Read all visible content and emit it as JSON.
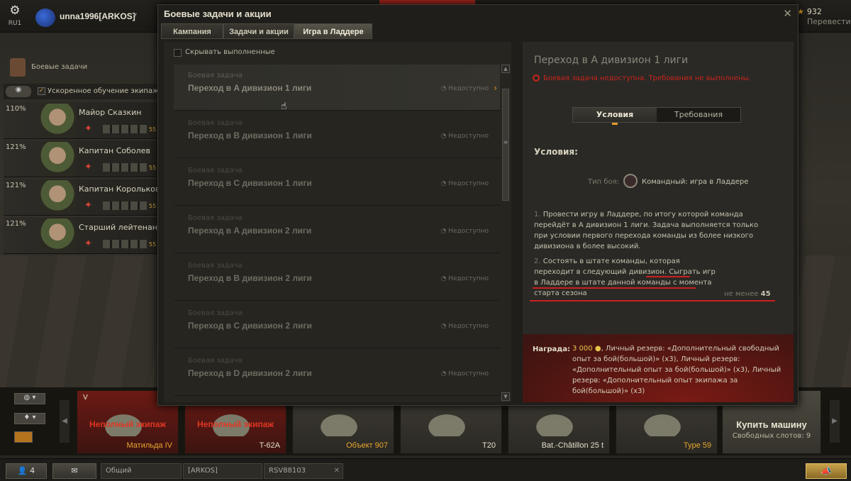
{
  "topbar": {
    "region": "RU1",
    "username": "unna1996[ARKOS]",
    "gold": "932",
    "translate": "Перевести"
  },
  "side": {
    "missions_label": "Боевые задачи",
    "crew_filter_label": "Ускоренное обучение экипажа",
    "crew": [
      {
        "pct": "110%",
        "name": "Майор Сказкин",
        "lvl": "55"
      },
      {
        "pct": "121%",
        "name": "Капитан Соболев",
        "lvl": "55"
      },
      {
        "pct": "121%",
        "name": "Капитан Корольков",
        "lvl": "55"
      },
      {
        "pct": "121%",
        "name": "Старший лейтенант С",
        "lvl": "55"
      }
    ]
  },
  "modal": {
    "title": "Боевые задачи и акции",
    "tabs": [
      "Кампания",
      "Задачи и акции",
      "Игра в Ладдере"
    ],
    "hide_completed": "Скрывать выполненные",
    "items": [
      {
        "kind": "Боевая задача",
        "title": "Переход в A дивизион 1 лиги",
        "status": "Недоступно"
      },
      {
        "kind": "Боевая задача",
        "title": "Переход в B дивизион 1 лиги",
        "status": "Недоступно"
      },
      {
        "kind": "Боевая задача",
        "title": "Переход в C дивизион 1 лиги",
        "status": "Недоступно"
      },
      {
        "kind": "Боевая задача",
        "title": "Переход в A дивизион 2 лиги",
        "status": "Недоступно"
      },
      {
        "kind": "Боевая задача",
        "title": "Переход в B дивизион 2 лиги",
        "status": "Недоступно"
      },
      {
        "kind": "Боевая задача",
        "title": "Переход в C дивизион 2 лиги",
        "status": "Недоступно"
      },
      {
        "kind": "Боевая задача",
        "title": "Переход в D дивизион 2 лиги",
        "status": "Недоступно"
      }
    ],
    "detail": {
      "title": "Переход в A дивизион 1 лиги",
      "warning": "Боевая задача недоступна. Требования не выполнены.",
      "subtabs": [
        "Условия",
        "Требования"
      ],
      "conditions_header": "Условия:",
      "battle_type_label": "Тип боя:",
      "battle_type_value": "Командный: игра в Ладдере",
      "cond1_num": "1.",
      "cond1_lines": [
        "Провести игру в Ладдере, по итогу которой команда",
        "перейдёт в A дивизион 1 лиги. Задача выполняется только",
        "при условии первого перехода команды из более низкого",
        "дивизиона в более высокий."
      ],
      "cond2_num": "2.",
      "cond2_lines": [
        "Состоять в штате команды, которая",
        "переходит в следующий дивизион. Сыграть игр",
        "в Ладдере в штате данной команды с момента",
        "старта сезона"
      ],
      "need_label": "не менее",
      "need_value": "45",
      "reward_label": "Награда:",
      "reward_credits": "3 000",
      "reward_text": ", Личный резерв: «Дополнительный свободный опыт за бой(большой)» (x3), Личный резерв: «Дополнительный опыт за бой(большой)» (x3), Личный резерв: «Дополнительный опыт экипажа за бой(большой)» (x3)"
    }
  },
  "carousel": {
    "tanks": [
      {
        "name": "Матильда IV",
        "warn": "Неполный экипаж",
        "tier": "V"
      },
      {
        "name": "T-62A",
        "warn": "Неполный экипаж",
        "tier": ""
      },
      {
        "name": "Объект 907",
        "warn": "",
        "tier": ""
      },
      {
        "name": "T20",
        "warn": "",
        "tier": ""
      },
      {
        "name": "Bat.-Châtillon 25 t",
        "warn": "",
        "tier": ""
      },
      {
        "name": "Type 59",
        "warn": "",
        "tier": ""
      }
    ],
    "buy_label": "Купить машину",
    "slots_label": "Свободных слотов: 9"
  },
  "bottom": {
    "friends_count": "4",
    "channel_general": "Общий",
    "channel_clan": "[ARKOS]",
    "channel_user": "RSV88103"
  }
}
